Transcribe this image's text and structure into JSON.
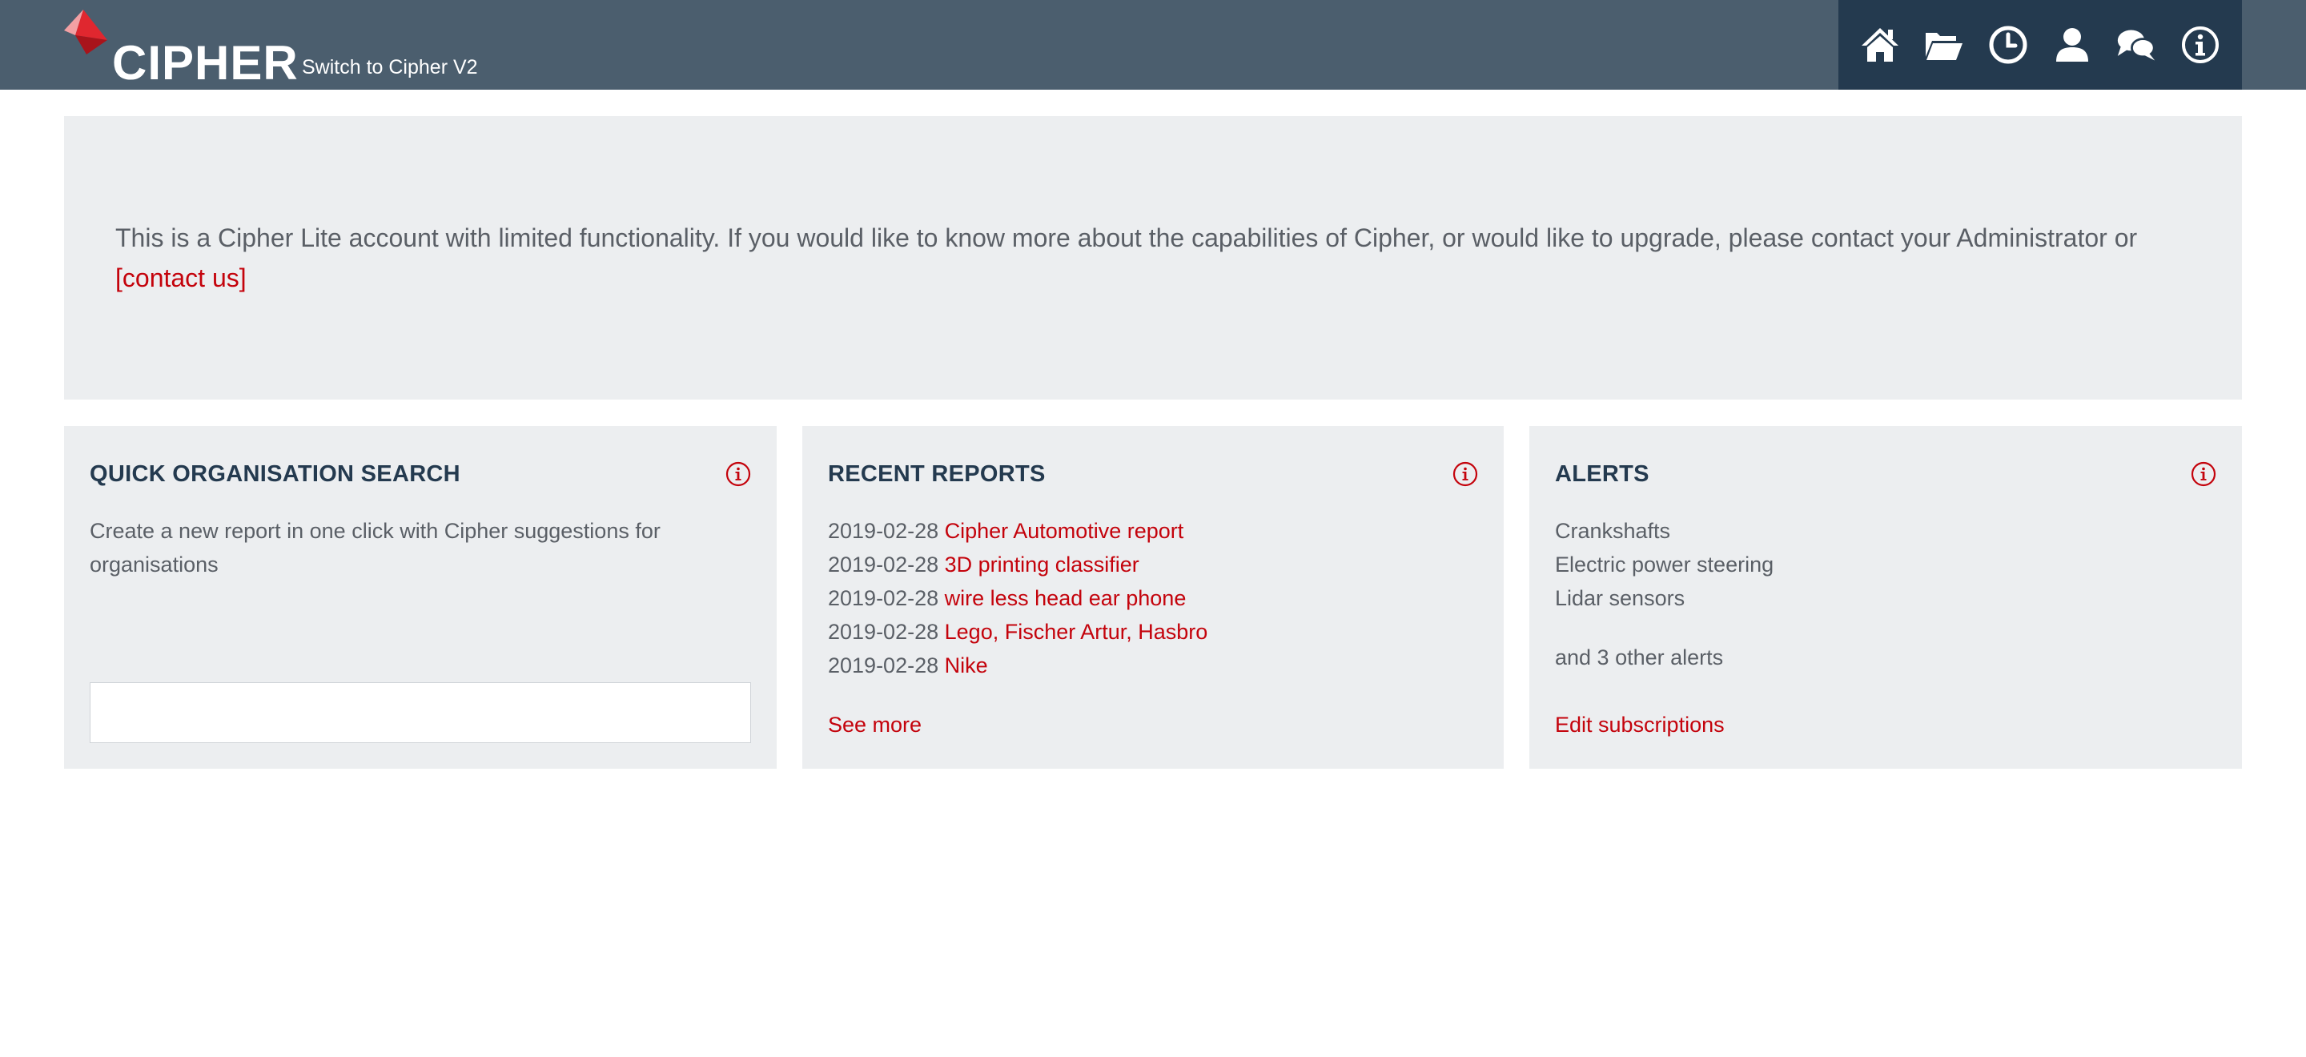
{
  "header": {
    "logo_text": "CIPHER",
    "switch_label": "Switch to Cipher V2",
    "nav_icons": [
      "home-icon",
      "folder-open-icon",
      "clock-icon",
      "user-icon",
      "chat-icon",
      "info-icon"
    ]
  },
  "notice": {
    "text": "This is a Cipher Lite account with limited functionality. If you would like to know more about the capabilities of Cipher, or would like to upgrade, please contact your Administrator or ",
    "link_label": "[contact us]"
  },
  "quick_search": {
    "title": "QUICK ORGANISATION SEARCH",
    "description": "Create a new report in one click with Cipher suggestions for organisations",
    "input_value": "",
    "input_placeholder": ""
  },
  "recent_reports": {
    "title": "RECENT REPORTS",
    "items": [
      {
        "date": "2019-02-28",
        "name": "Cipher Automotive report"
      },
      {
        "date": "2019-02-28",
        "name": "3D printing classifier"
      },
      {
        "date": "2019-02-28",
        "name": "wire less head ear phone"
      },
      {
        "date": "2019-02-28",
        "name": "Lego, Fischer Artur, Hasbro"
      },
      {
        "date": "2019-02-28",
        "name": "Nike"
      }
    ],
    "see_more_label": "See more"
  },
  "alerts": {
    "title": "ALERTS",
    "items": [
      "Crankshafts",
      "Electric power steering",
      "Lidar sensors"
    ],
    "more_text": "and 3 other alerts",
    "edit_label": "Edit subscriptions"
  },
  "colors": {
    "topbar": "#4b5e6e",
    "nav_bg": "#243a4f",
    "accent_red": "#c4030c",
    "panel_bg": "#eceef0",
    "title_color": "#243a4f"
  }
}
